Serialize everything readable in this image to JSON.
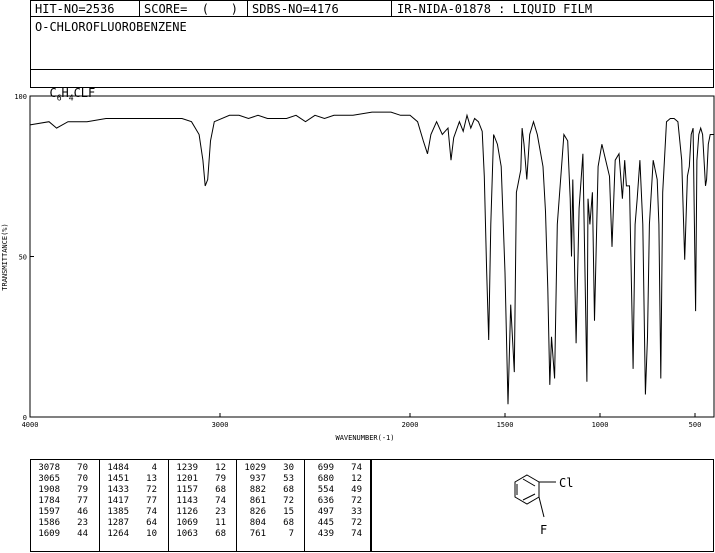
{
  "header": {
    "hit_no": "HIT-NO=2536",
    "score": "SCORE=  (   )",
    "sdbs_no": "SDBS-NO=4176",
    "ir_id": "IR-NIDA-01878 : LIQUID FILM",
    "compound": "O-CHLOROFLUOROBENZENE",
    "formula_c": "C",
    "formula_c_sub": "6",
    "formula_h": "H",
    "formula_h_sub": "4",
    "formula_rest": "CLF"
  },
  "chart_data": {
    "type": "line",
    "title": "",
    "xlabel": "WAVENUMBER(-1)",
    "ylabel": "TRANSMITTANCE(%)",
    "xlim": [
      4000,
      400
    ],
    "ylim": [
      0,
      100
    ],
    "x_ticks": [
      4000,
      3000,
      2000,
      1500,
      1000,
      500
    ],
    "y_ticks": [
      0,
      50,
      100
    ],
    "series": [
      {
        "points": [
          [
            4000,
            91
          ],
          [
            3900,
            92
          ],
          [
            3860,
            90
          ],
          [
            3800,
            92
          ],
          [
            3700,
            92
          ],
          [
            3600,
            93
          ],
          [
            3500,
            93
          ],
          [
            3400,
            93
          ],
          [
            3300,
            93
          ],
          [
            3200,
            93
          ],
          [
            3150,
            92
          ],
          [
            3110,
            88
          ],
          [
            3090,
            80
          ],
          [
            3078,
            72
          ],
          [
            3065,
            74
          ],
          [
            3050,
            86
          ],
          [
            3030,
            92
          ],
          [
            2950,
            94
          ],
          [
            2900,
            94
          ],
          [
            2850,
            93
          ],
          [
            2800,
            94
          ],
          [
            2750,
            93
          ],
          [
            2700,
            93
          ],
          [
            2650,
            93
          ],
          [
            2600,
            94
          ],
          [
            2550,
            92
          ],
          [
            2500,
            94
          ],
          [
            2450,
            93
          ],
          [
            2400,
            94
          ],
          [
            2300,
            94
          ],
          [
            2200,
            95
          ],
          [
            2100,
            95
          ],
          [
            2050,
            94
          ],
          [
            2000,
            94
          ],
          [
            1960,
            92
          ],
          [
            1930,
            86
          ],
          [
            1908,
            82
          ],
          [
            1890,
            88
          ],
          [
            1860,
            92
          ],
          [
            1830,
            88
          ],
          [
            1800,
            90
          ],
          [
            1784,
            80
          ],
          [
            1770,
            87
          ],
          [
            1740,
            92
          ],
          [
            1720,
            89
          ],
          [
            1700,
            94
          ],
          [
            1680,
            90
          ],
          [
            1660,
            93
          ],
          [
            1640,
            92
          ],
          [
            1620,
            89
          ],
          [
            1609,
            75
          ],
          [
            1597,
            46
          ],
          [
            1586,
            24
          ],
          [
            1575,
            60
          ],
          [
            1560,
            88
          ],
          [
            1540,
            85
          ],
          [
            1520,
            78
          ],
          [
            1500,
            45
          ],
          [
            1484,
            4
          ],
          [
            1470,
            35
          ],
          [
            1451,
            14
          ],
          [
            1440,
            70
          ],
          [
            1433,
            72
          ],
          [
            1417,
            77
          ],
          [
            1410,
            90
          ],
          [
            1400,
            85
          ],
          [
            1385,
            74
          ],
          [
            1370,
            88
          ],
          [
            1350,
            92
          ],
          [
            1330,
            88
          ],
          [
            1300,
            78
          ],
          [
            1287,
            64
          ],
          [
            1275,
            40
          ],
          [
            1264,
            10
          ],
          [
            1255,
            25
          ],
          [
            1239,
            12
          ],
          [
            1225,
            60
          ],
          [
            1201,
            79
          ],
          [
            1190,
            88
          ],
          [
            1170,
            86
          ],
          [
            1157,
            68
          ],
          [
            1150,
            50
          ],
          [
            1143,
            74
          ],
          [
            1126,
            23
          ],
          [
            1110,
            65
          ],
          [
            1090,
            82
          ],
          [
            1069,
            11
          ],
          [
            1063,
            68
          ],
          [
            1053,
            60
          ],
          [
            1040,
            70
          ],
          [
            1029,
            30
          ],
          [
            1010,
            78
          ],
          [
            990,
            85
          ],
          [
            970,
            80
          ],
          [
            950,
            75
          ],
          [
            937,
            53
          ],
          [
            920,
            80
          ],
          [
            900,
            82
          ],
          [
            882,
            68
          ],
          [
            870,
            80
          ],
          [
            861,
            72
          ],
          [
            845,
            72
          ],
          [
            826,
            15
          ],
          [
            815,
            60
          ],
          [
            804,
            68
          ],
          [
            790,
            80
          ],
          [
            775,
            60
          ],
          [
            761,
            7
          ],
          [
            750,
            25
          ],
          [
            740,
            60
          ],
          [
            720,
            80
          ],
          [
            699,
            74
          ],
          [
            690,
            60
          ],
          [
            680,
            12
          ],
          [
            670,
            70
          ],
          [
            650,
            92
          ],
          [
            630,
            93
          ],
          [
            610,
            93
          ],
          [
            590,
            92
          ],
          [
            570,
            80
          ],
          [
            554,
            49
          ],
          [
            540,
            75
          ],
          [
            530,
            78
          ],
          [
            520,
            88
          ],
          [
            510,
            90
          ],
          [
            497,
            33
          ],
          [
            490,
            80
          ],
          [
            480,
            88
          ],
          [
            470,
            90
          ],
          [
            460,
            88
          ],
          [
            445,
            72
          ],
          [
            439,
            74
          ],
          [
            430,
            85
          ],
          [
            420,
            88
          ],
          [
            400,
            88
          ]
        ]
      }
    ]
  },
  "peaks": [
    [
      [
        "3078",
        "70"
      ],
      [
        "3065",
        "70"
      ],
      [
        "1908",
        "79"
      ],
      [
        "1784",
        "77"
      ],
      [
        "1597",
        "46"
      ],
      [
        "1586",
        "23"
      ],
      [
        "1609",
        "44"
      ]
    ],
    [
      [
        "1484",
        "4"
      ],
      [
        "1451",
        "13"
      ],
      [
        "1433",
        "72"
      ],
      [
        "1417",
        "77"
      ],
      [
        "1385",
        "74"
      ],
      [
        "1287",
        "64"
      ],
      [
        "1264",
        "10"
      ]
    ],
    [
      [
        "1239",
        "12"
      ],
      [
        "1201",
        "79"
      ],
      [
        "1157",
        "68"
      ],
      [
        "1143",
        "74"
      ],
      [
        "1126",
        "23"
      ],
      [
        "1069",
        "11"
      ],
      [
        "1063",
        "68"
      ]
    ],
    [
      [
        "1029",
        "30"
      ],
      [
        "937",
        "53"
      ],
      [
        "882",
        "68"
      ],
      [
        "861",
        "72"
      ],
      [
        "826",
        "15"
      ],
      [
        "804",
        "68"
      ],
      [
        "761",
        "7"
      ]
    ],
    [
      [
        "699",
        "74"
      ],
      [
        "680",
        "12"
      ],
      [
        "554",
        "49"
      ],
      [
        "636",
        "72"
      ],
      [
        "497",
        "33"
      ],
      [
        "445",
        "72"
      ],
      [
        "439",
        "74"
      ]
    ]
  ],
  "structure": {
    "cl_label": "Cl",
    "f_label": "F"
  }
}
